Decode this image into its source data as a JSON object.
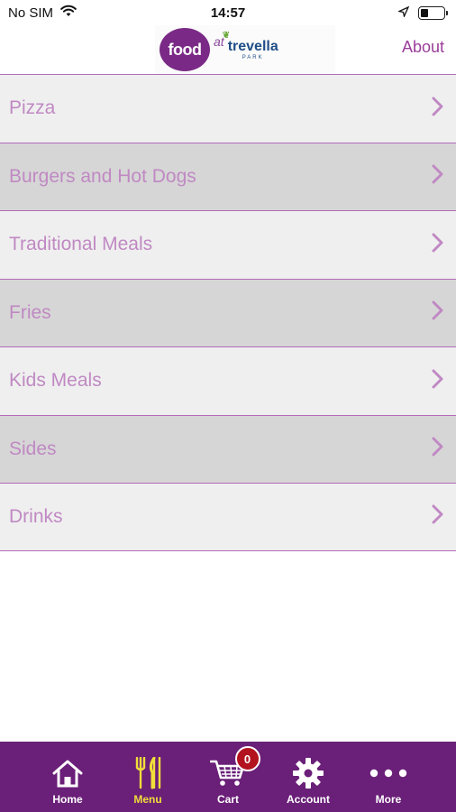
{
  "status_bar": {
    "carrier": "No SIM",
    "time": "14:57",
    "battery_level": 0.35
  },
  "header": {
    "logo_food": "food",
    "logo_at": "at",
    "logo_park": "trevella",
    "logo_park_sub": "PARK",
    "about_label": "About"
  },
  "menu": {
    "items": [
      {
        "label": "Pizza"
      },
      {
        "label": "Burgers and Hot Dogs"
      },
      {
        "label": "Traditional Meals"
      },
      {
        "label": "Fries"
      },
      {
        "label": "Kids Meals"
      },
      {
        "label": "Sides"
      },
      {
        "label": "Drinks"
      }
    ]
  },
  "tab_bar": {
    "tabs": [
      {
        "label": "Home",
        "icon": "home-icon"
      },
      {
        "label": "Menu",
        "icon": "cutlery-icon",
        "active": true
      },
      {
        "label": "Cart",
        "icon": "cart-icon",
        "badge": "0"
      },
      {
        "label": "Account",
        "icon": "gear-icon"
      },
      {
        "label": "More",
        "icon": "more-dots-icon"
      }
    ]
  },
  "colors": {
    "accent": "#6a1f78",
    "menu_text": "#c089c3",
    "divider": "#b36bb7",
    "active_tab": "#f0de3a",
    "badge": "#b3121f"
  }
}
